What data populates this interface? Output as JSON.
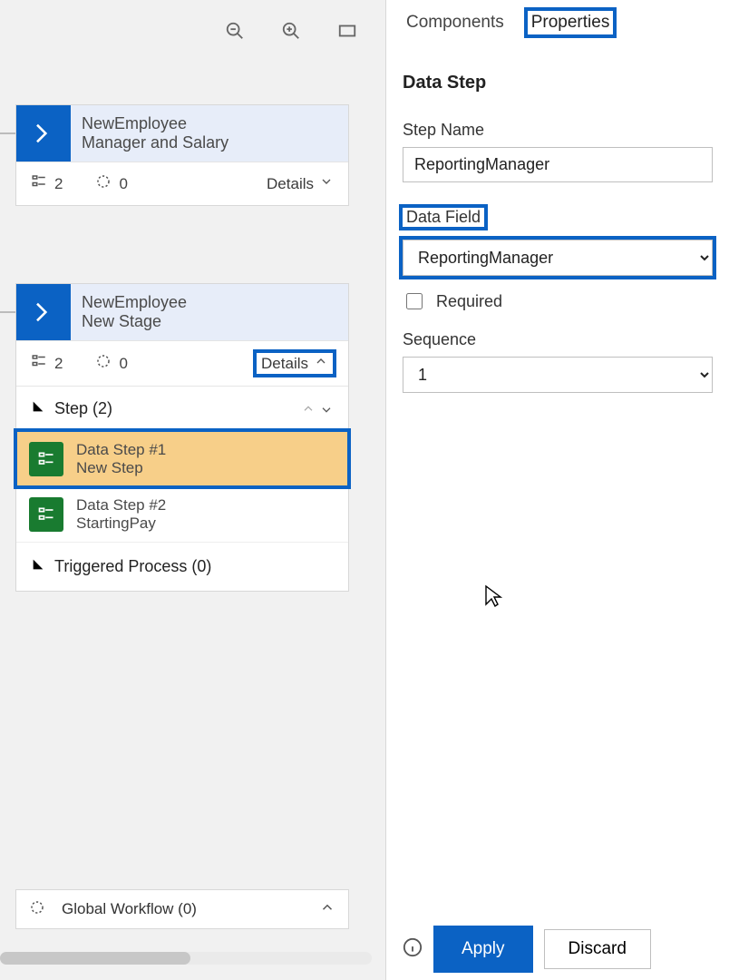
{
  "canvas": {
    "stages": [
      {
        "entity": "NewEmployee",
        "name": "Manager and Salary",
        "steps": 2,
        "triggers": 0,
        "details_label": "Details"
      },
      {
        "entity": "NewEmployee",
        "name": "New Stage",
        "steps": 2,
        "triggers": 0,
        "details_label": "Details",
        "step_header": "Step (2)",
        "step_items": [
          {
            "title": "Data Step #1",
            "subtitle": "New Step",
            "selected": true
          },
          {
            "title": "Data Step #2",
            "subtitle": "StartingPay",
            "selected": false
          }
        ],
        "triggered_label": "Triggered Process (0)"
      }
    ],
    "global_workflow": "Global Workflow (0)"
  },
  "panel": {
    "tabs": {
      "components": "Components",
      "properties": "Properties"
    },
    "title": "Data Step",
    "step_name_label": "Step Name",
    "step_name_value": "ReportingManager",
    "data_field_label": "Data Field",
    "data_field_value": "ReportingManager",
    "required_label": "Required",
    "sequence_label": "Sequence",
    "sequence_value": "1",
    "buttons": {
      "apply": "Apply",
      "discard": "Discard"
    }
  }
}
